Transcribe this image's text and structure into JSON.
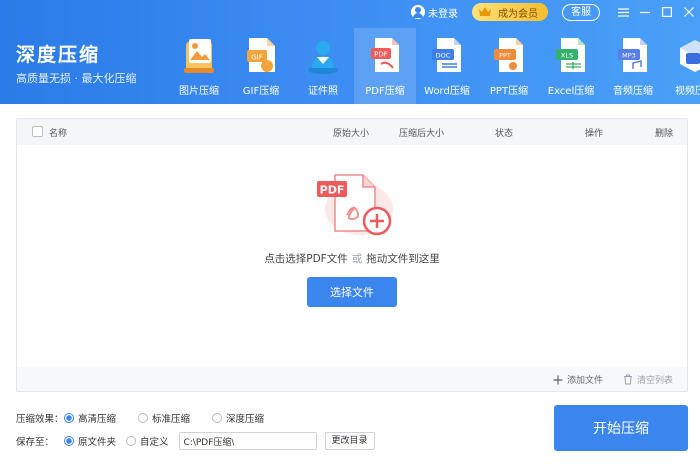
{
  "brand": {
    "title": "深度压缩",
    "subtitle": "高质量无损 · 最大化压缩"
  },
  "topbar": {
    "login": "未登录",
    "vip": "成为会员",
    "service": "客服",
    "menu_icon": "menu-icon",
    "minimize_icon": "minimize-icon",
    "maximize_icon": "maximize-icon",
    "close_icon": "close-icon"
  },
  "tabs": [
    {
      "label": "图片压缩",
      "icon": "image-icon",
      "color": "#f39b3a"
    },
    {
      "label": "GIF压缩",
      "icon": "gif-icon",
      "color": "#f1a43c"
    },
    {
      "label": "证件照",
      "icon": "id-photo-icon",
      "color": "#2aa8f0"
    },
    {
      "label": "PDF压缩",
      "icon": "pdf-icon",
      "color": "#ef5b5b"
    },
    {
      "label": "Word压缩",
      "icon": "word-icon",
      "color": "#3f7ee8"
    },
    {
      "label": "PPT压缩",
      "icon": "ppt-icon",
      "color": "#f08b3c"
    },
    {
      "label": "Excel压缩",
      "icon": "excel-icon",
      "color": "#36b06a"
    },
    {
      "label": "音频压缩",
      "icon": "audio-icon",
      "color": "#5b7de8"
    },
    {
      "label": "视频压缩",
      "icon": "video-icon",
      "color": "#3a6fe0"
    }
  ],
  "active_tab": "PDF压缩",
  "table": {
    "headers": {
      "name": "名称",
      "original_size": "原始大小",
      "compressed_size": "压缩后大小",
      "status": "状态",
      "action": "操作",
      "delete": "删除"
    }
  },
  "dropzone": {
    "text_before": "点击选择PDF文件",
    "or": "或",
    "text_after": "拖动文件到这里",
    "button": "选择文件",
    "icon_text": "PDF"
  },
  "footer": {
    "add_file": "添加文件",
    "clear_list": "清空列表"
  },
  "options": {
    "effect_label": "压缩效果：",
    "effects": [
      {
        "label": "高清压缩",
        "checked": true
      },
      {
        "label": "标准压缩",
        "checked": false
      },
      {
        "label": "深度压缩",
        "checked": false
      }
    ],
    "save_label": "保存至：",
    "save_original": "原文件夹",
    "save_custom": "自定义",
    "save_path": "C:\\PDF压缩\\",
    "change_dir": "更改目录"
  },
  "start_button": "开始压缩",
  "colors": {
    "primary": "#3b86ee",
    "header_start": "#2b7be8",
    "header_end": "#4aa0f7",
    "pdf_red": "#ef5b5b"
  }
}
